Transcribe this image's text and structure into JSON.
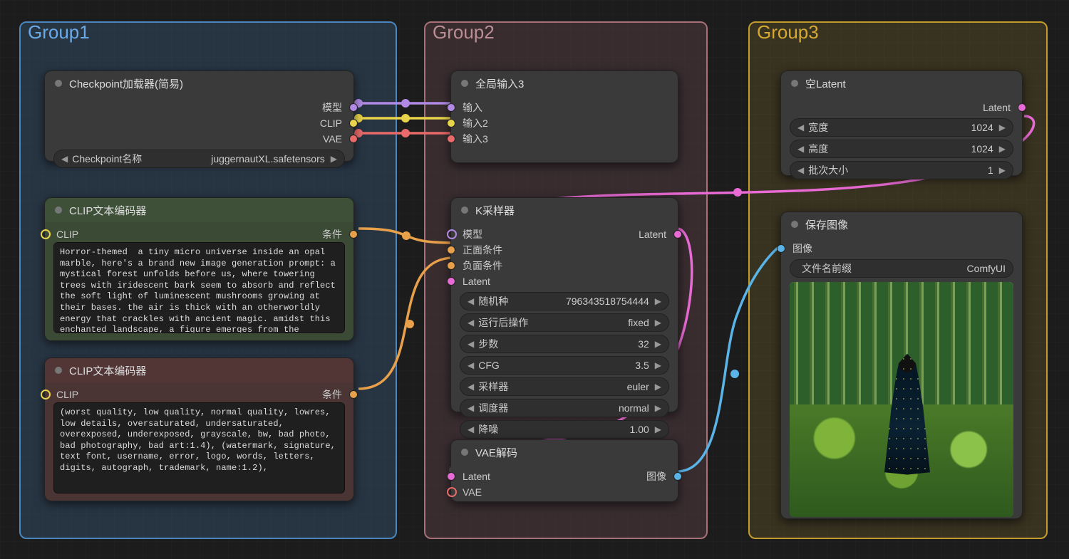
{
  "groups": {
    "g1": "Group1",
    "g2": "Group2",
    "g3": "Group3"
  },
  "checkpoint_loader": {
    "title": "Checkpoint加载器(简易)",
    "out_model": "模型",
    "out_clip": "CLIP",
    "out_vae": "VAE",
    "widget_label": "Checkpoint名称",
    "widget_value": "juggernautXL.safetensors"
  },
  "clip_pos": {
    "title": "CLIP文本编码器",
    "in_clip": "CLIP",
    "out_cond": "条件",
    "text": "Horror-themed  a tiny micro universe inside an opal marble, here's a brand new image generation prompt: a mystical forest unfolds before us, where towering trees with iridescent bark seem to absorb and reflect the soft light of luminescent mushrooms growing at their bases. the air is thick with an otherworldly energy that crackles with ancient magic. amidst this enchanted landscape, a figure emerges from the shadows: a being with skin like polished obsidian, adorned in a flowing cloak that shimmers with tiny, glittering stars. their eyes burn with an inner light as they walk towards us, their very presence seeming to awaken the forest's"
  },
  "clip_neg": {
    "title": "CLIP文本编码器",
    "in_clip": "CLIP",
    "out_cond": "条件",
    "text": "(worst quality, low quality, normal quality, lowres, low details, oversaturated, undersaturated, overexposed, underexposed, grayscale, bw, bad photo, bad photography, bad art:1.4), (watermark, signature, text font, username, error, logo, words, letters, digits, autograph, trademark, name:1.2),"
  },
  "reroute": {
    "title": "全局输入3",
    "in1": "输入",
    "in2": "输入2",
    "in3": "输入3"
  },
  "ksampler": {
    "title": "K采样器",
    "in_model": "模型",
    "in_pos": "正面条件",
    "in_neg": "负面条件",
    "in_latent": "Latent",
    "out_latent": "Latent",
    "w_seed_label": "随机种",
    "w_seed_value": "796343518754444",
    "w_after_label": "运行后操作",
    "w_after_value": "fixed",
    "w_steps_label": "步数",
    "w_steps_value": "32",
    "w_cfg_label": "CFG",
    "w_cfg_value": "3.5",
    "w_sampler_label": "采样器",
    "w_sampler_value": "euler",
    "w_sched_label": "调度器",
    "w_sched_value": "normal",
    "w_denoise_label": "降噪",
    "w_denoise_value": "1.00"
  },
  "vae_decode": {
    "title": "VAE解码",
    "in_latent": "Latent",
    "in_vae": "VAE",
    "out_image": "图像"
  },
  "empty_latent": {
    "title": "空Latent",
    "out_latent": "Latent",
    "w_width_label": "宽度",
    "w_width_value": "1024",
    "w_height_label": "高度",
    "w_height_value": "1024",
    "w_batch_label": "批次大小",
    "w_batch_value": "1"
  },
  "save_image": {
    "title": "保存图像",
    "in_image": "图像",
    "w_prefix_label": "文件名前缀",
    "w_prefix_value": "ComfyUI"
  },
  "colors": {
    "model": "#b28ae6",
    "clip": "#e8d34a",
    "vae": "#e86a6a",
    "cond": "#e8a04a",
    "latent": "#e86ad4",
    "image": "#5ab4e8"
  }
}
